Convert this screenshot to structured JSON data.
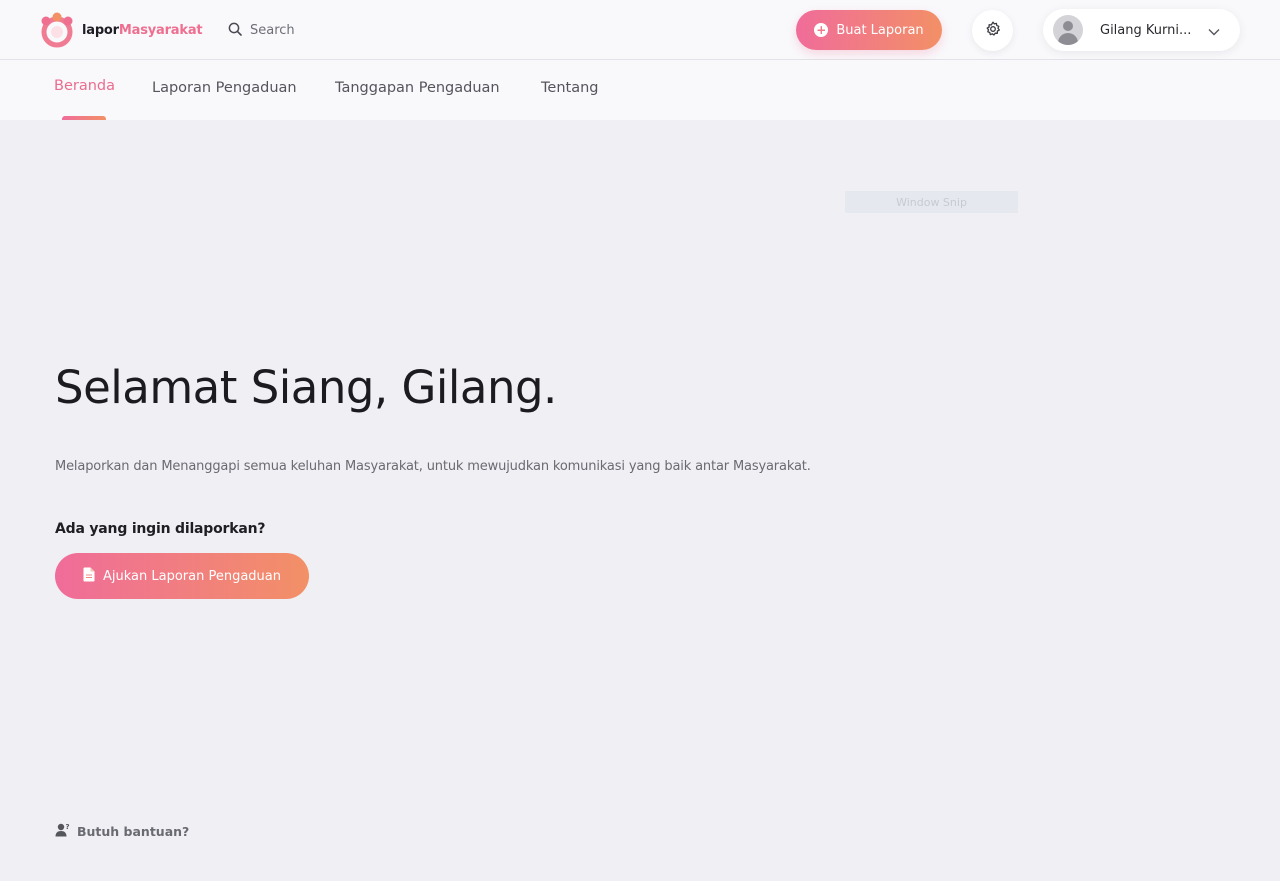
{
  "brand": {
    "name_part1": "lapor",
    "name_part2": "Masyarakat",
    "accent_color": "#ee6f8f",
    "gradient_start": "#f06c9a",
    "gradient_end": "#f29066"
  },
  "header": {
    "search_placeholder": "Search",
    "create_report_label": "Buat Laporan",
    "user_name": "Gilang Kurni...",
    "icons": [
      "logo-icon",
      "search-icon",
      "plus-circle-icon",
      "gear-icon",
      "avatar-icon",
      "chevron-down-icon"
    ]
  },
  "nav": {
    "tabs": [
      {
        "label": "Beranda",
        "active": true
      },
      {
        "label": "Laporan Pengaduan",
        "active": false
      },
      {
        "label": "Tanggapan Pengaduan",
        "active": false
      },
      {
        "label": "Tentang",
        "active": false
      }
    ]
  },
  "overlay": {
    "snip_label": "Window Snip"
  },
  "main": {
    "greeting": "Selamat Siang, Gilang.",
    "description": "Melaporkan dan Menanggapi semua keluhan Masyarakat, untuk mewujudkan komunikasi yang baik antar Masyarakat.",
    "question": "Ada yang ingin dilaporkan?",
    "cta_label": "Ajukan Laporan Pengaduan"
  },
  "footer": {
    "help_label": "Butuh bantuan?"
  }
}
